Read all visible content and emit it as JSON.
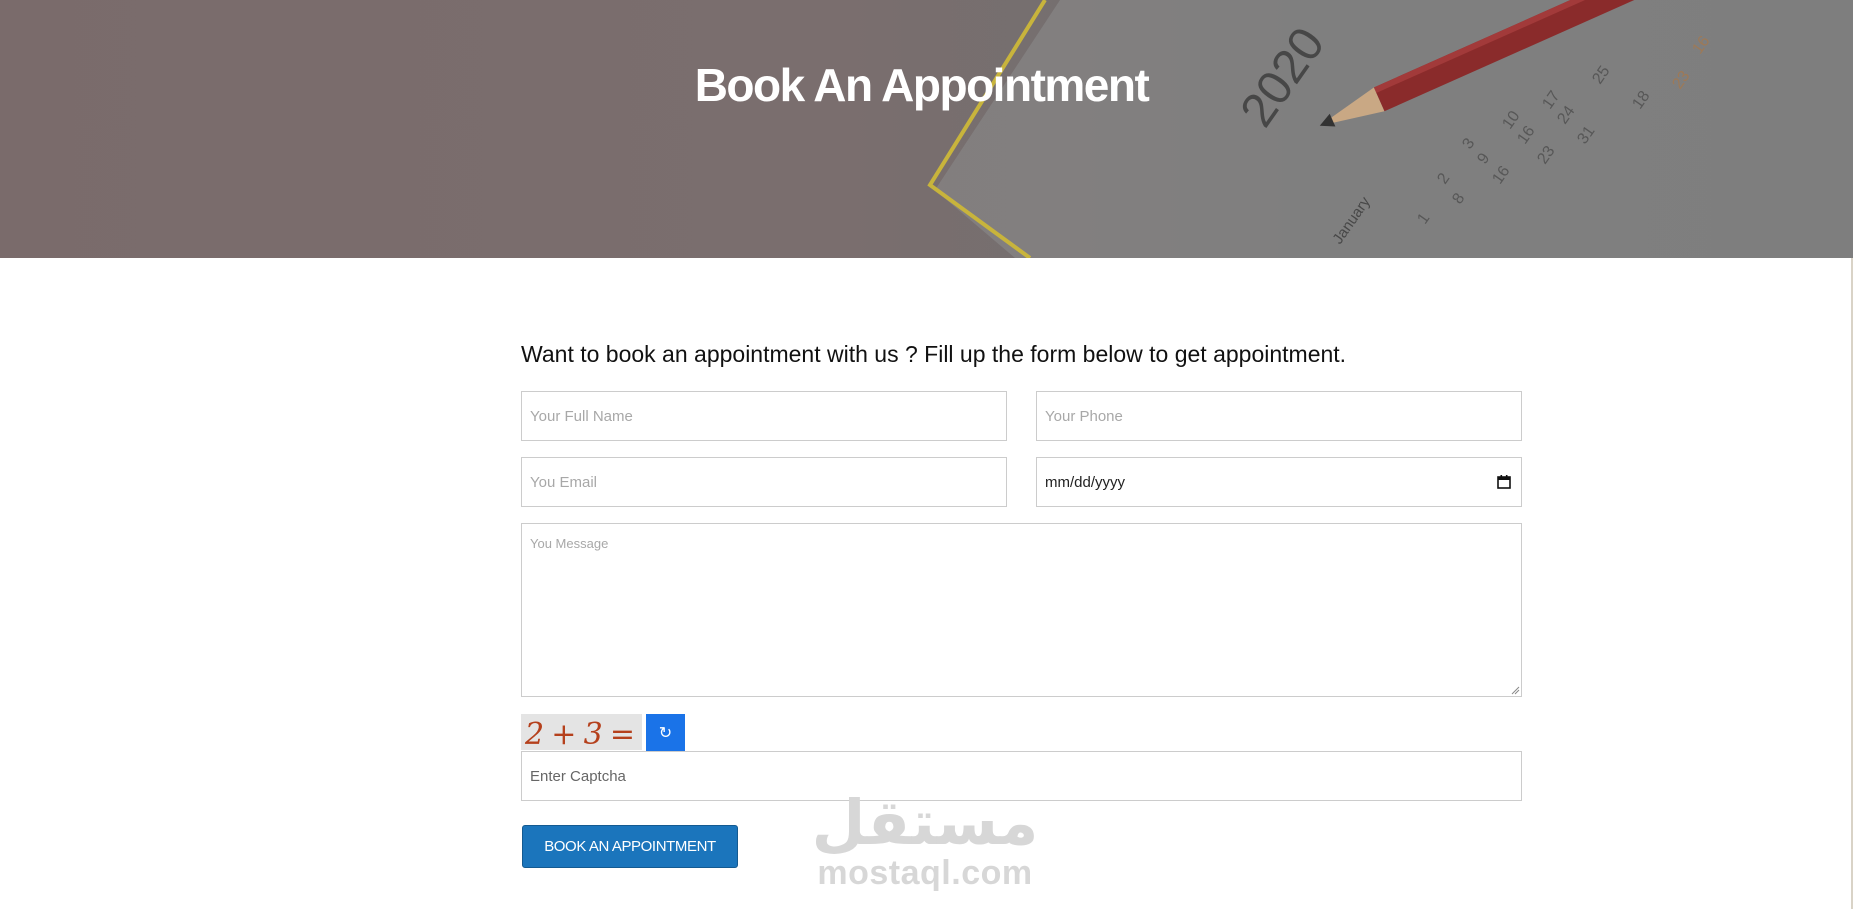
{
  "hero": {
    "title": "Book An Appointment",
    "background_year": "2020",
    "background_month": "January"
  },
  "form": {
    "intro": "Want to book an appointment with us ? Fill up the form below to get appointment.",
    "full_name_placeholder": "Your Full Name",
    "phone_placeholder": "Your Phone",
    "email_placeholder": "You Email",
    "date_value": "mm/dd/yyyy",
    "message_placeholder": "You Message",
    "captcha_text": "2+3=",
    "captcha_refresh_glyph": "↻",
    "captcha_placeholder": "Enter Captcha",
    "submit_label": "BOOK AN APPOINTMENT"
  },
  "watermark": {
    "arabic": "مستقل",
    "latin": "mostaql.com"
  },
  "colors": {
    "accent": "#1b75bc",
    "refresh": "#1a73e8",
    "captcha_ink": "#b5401c"
  }
}
